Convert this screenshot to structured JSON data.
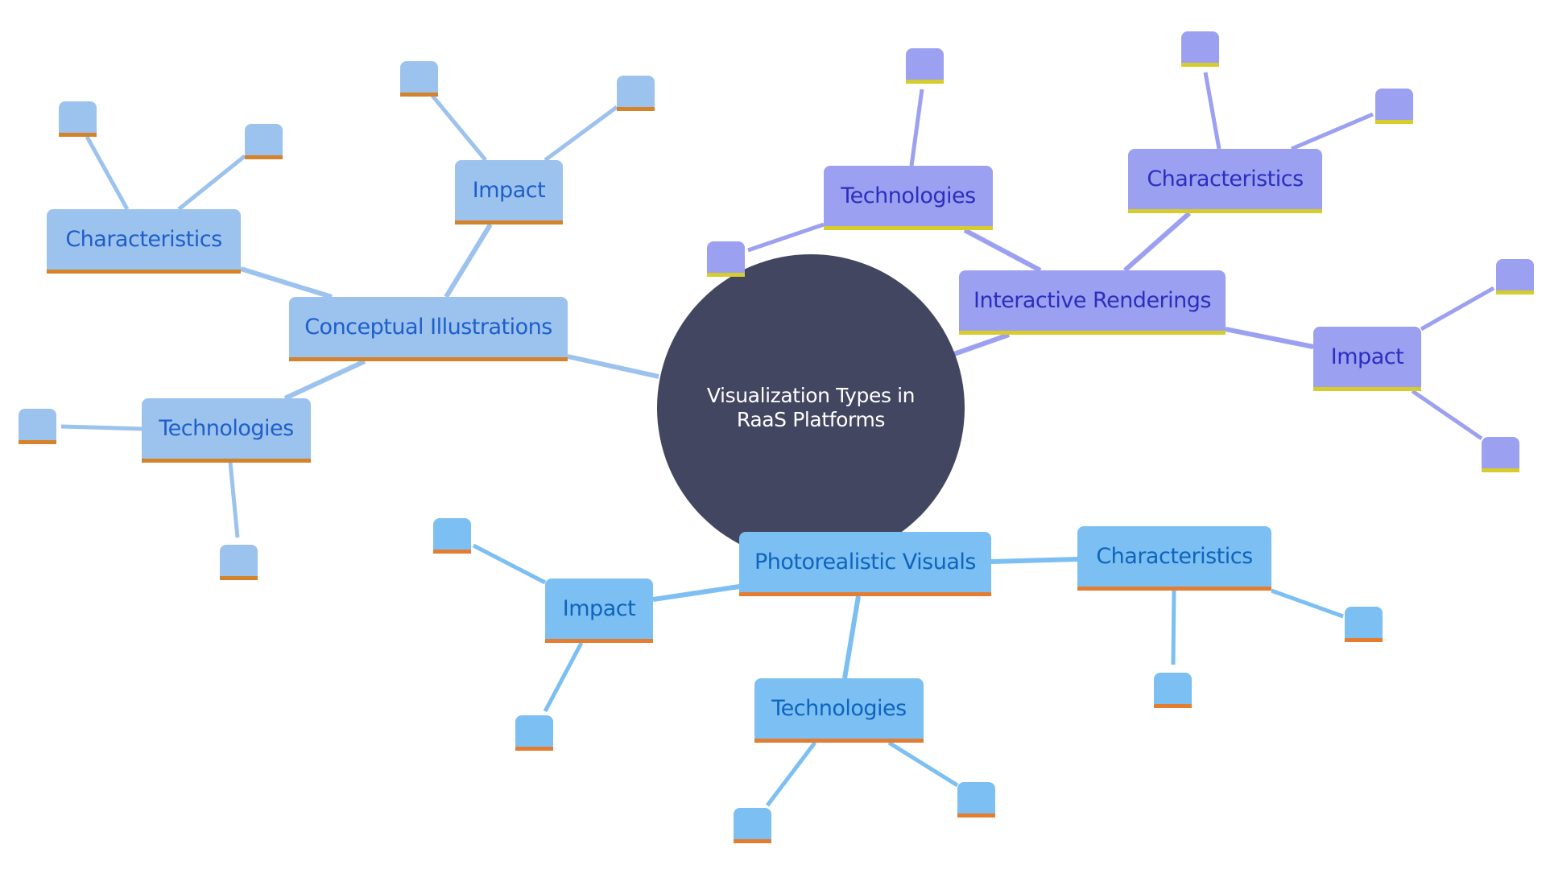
{
  "root": {
    "label": "Visualization Types in RaaS Platforms"
  },
  "branches": [
    {
      "label": "Conceptual Illustrations",
      "colors": {
        "fill": "#9CC2EE",
        "text": "#1E5FC9",
        "underline": "#D4832A",
        "edge": "#9CC2EE"
      },
      "children": [
        {
          "label": "Characteristics",
          "leaves": 2
        },
        {
          "label": "Impact",
          "leaves": 2
        },
        {
          "label": "Technologies",
          "leaves": 2
        }
      ]
    },
    {
      "label": "Interactive Renderings",
      "colors": {
        "fill": "#9CA0F0",
        "text": "#2A2FBF",
        "underline": "#D6CC2C",
        "edge": "#9CA0F0"
      },
      "children": [
        {
          "label": "Technologies",
          "leaves": 2
        },
        {
          "label": "Characteristics",
          "leaves": 2
        },
        {
          "label": "Impact",
          "leaves": 2
        }
      ]
    },
    {
      "label": "Photorealistic Visuals",
      "colors": {
        "fill": "#7CBFF2",
        "text": "#0F64BE",
        "underline": "#E57D31",
        "edge": "#7CBFF2"
      },
      "children": [
        {
          "label": "Impact",
          "leaves": 2
        },
        {
          "label": "Technologies",
          "leaves": 2
        },
        {
          "label": "Characteristics",
          "leaves": 2
        }
      ]
    }
  ]
}
